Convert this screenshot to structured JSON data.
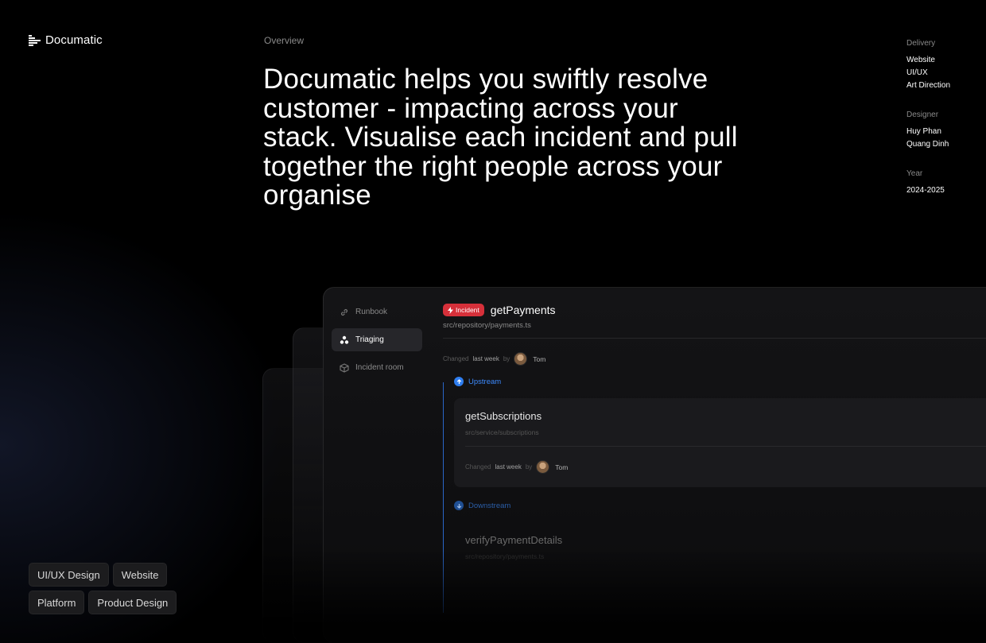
{
  "brand": {
    "name": "Documatic"
  },
  "overview": {
    "label": "Overview",
    "headline": "Documatic helps you swiftly resolve customer - impacting  across your stack. Visualise each incident and pull together the right people across your organise"
  },
  "meta": {
    "delivery": {
      "label": "Delivery",
      "items": [
        "Website",
        "UI/UX",
        "Art Direction"
      ]
    },
    "designer": {
      "label": "Designer",
      "items": [
        "Huy Phan",
        "Quang Dinh"
      ]
    },
    "year": {
      "label": "Year",
      "value": "2024-2025"
    }
  },
  "app": {
    "nav": [
      {
        "label": "Runbook",
        "icon": "link-icon",
        "active": false
      },
      {
        "label": "Triaging",
        "icon": "triangle-dots-icon",
        "active": true
      },
      {
        "label": "Incident room",
        "icon": "cube-icon",
        "active": false
      }
    ],
    "badge": {
      "label": "Incident",
      "icon": "lightning-icon",
      "color": "#d6303a"
    },
    "title": "getPayments",
    "path": "src/repository/payments.ts",
    "changed": {
      "prefix": "Changed",
      "when": "last week",
      "by": "by",
      "user": "Tom"
    },
    "upstream": {
      "label": "Upstream",
      "item": {
        "title": "getSubscriptions",
        "path": "src/service/subscriptions",
        "changed": {
          "prefix": "Changed",
          "when": "last week",
          "by": "by",
          "user": "Tom"
        }
      }
    },
    "downstream": {
      "label": "Downstream",
      "item": {
        "title": "verifyPaymentDetails",
        "path": "src/repository/payments.ts"
      }
    }
  },
  "tags": [
    [
      "UI/UX Design",
      "Website"
    ],
    [
      "Platform",
      "Product Design"
    ]
  ],
  "colors": {
    "accent": "#2f7ef0",
    "incident": "#d6303a",
    "background": "#000000"
  }
}
